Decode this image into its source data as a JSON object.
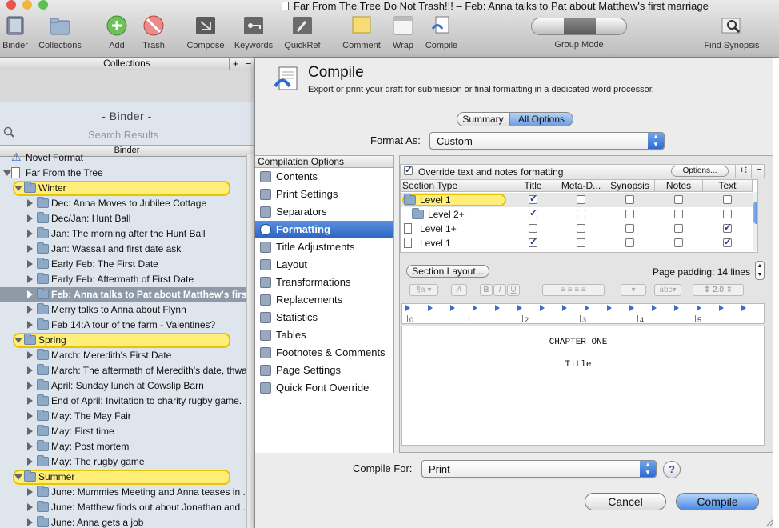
{
  "window": {
    "title": "Far From The Tree Do Not Trash!!! – Feb: Anna talks to Pat about Matthew's first marriage",
    "traffic_colors": [
      "#e9574c",
      "#f4b43f",
      "#5cc24e"
    ]
  },
  "toolbar": {
    "items": [
      {
        "label": "Binder",
        "icon": "binder-icon"
      },
      {
        "label": "Collections",
        "icon": "collections-icon"
      },
      {
        "label": "Add",
        "icon": "add-icon"
      },
      {
        "label": "Trash",
        "icon": "trash-icon"
      },
      {
        "label": "Compose",
        "icon": "compose-icon"
      },
      {
        "label": "Keywords",
        "icon": "keywords-icon"
      },
      {
        "label": "QuickRef",
        "icon": "quickref-icon"
      },
      {
        "label": "Comment",
        "icon": "comment-icon"
      },
      {
        "label": "Wrap",
        "icon": "wrap-icon"
      },
      {
        "label": "Compile",
        "icon": "compile-icon"
      },
      {
        "label": "Group Mode",
        "icon": "group-mode-icon"
      },
      {
        "label": "Find Synopsis",
        "icon": "find-synopsis-icon"
      }
    ]
  },
  "sidebar": {
    "collections_label": "Collections",
    "binder_heading": "- Binder -",
    "search_placeholder": "Search Results",
    "binder_bar": "Binder",
    "items": [
      {
        "label": "Novel Format",
        "kind": "warning",
        "indent": 0
      },
      {
        "label": "Far From the Tree",
        "kind": "doc",
        "indent": 0,
        "open": true
      },
      {
        "label": "Winter",
        "kind": "group",
        "indent": 1,
        "open": true
      },
      {
        "label": "Dec: Anna Moves to Jubilee Cottage",
        "kind": "folder",
        "indent": 2
      },
      {
        "label": "Dec/Jan: Hunt Ball",
        "kind": "folder",
        "indent": 2
      },
      {
        "label": "Jan: The morning after the Hunt Ball",
        "kind": "folder",
        "indent": 2
      },
      {
        "label": "Jan: Wassail and first date ask",
        "kind": "folder",
        "indent": 2
      },
      {
        "label": "Early Feb: The First Date",
        "kind": "folder",
        "indent": 2
      },
      {
        "label": "Early Feb: Aftermath of First Date",
        "kind": "folder",
        "indent": 2
      },
      {
        "label": "Feb: Anna talks to Pat about Matthew's first marriage",
        "kind": "folder",
        "indent": 2,
        "selected": true
      },
      {
        "label": "Merry talks to Anna about Flynn",
        "kind": "folder",
        "indent": 2
      },
      {
        "label": "Feb 14:A tour of the farm - Valentines?",
        "kind": "folder",
        "indent": 2
      },
      {
        "label": "Spring",
        "kind": "group",
        "indent": 1,
        "open": true
      },
      {
        "label": "March: Meredith's First Date",
        "kind": "folder",
        "indent": 2
      },
      {
        "label": "March: The aftermath of Meredith's date, thwarted passion",
        "kind": "folder",
        "indent": 2
      },
      {
        "label": "April: Sunday lunch at Cowslip Barn",
        "kind": "folder",
        "indent": 2
      },
      {
        "label": "End of April: Invitation to charity rugby game.",
        "kind": "folder",
        "indent": 2
      },
      {
        "label": "May: The May Fair",
        "kind": "folder",
        "indent": 2
      },
      {
        "label": "May: First time",
        "kind": "folder",
        "indent": 2
      },
      {
        "label": "May: Post mortem",
        "kind": "folder",
        "indent": 2
      },
      {
        "label": "May: The rugby game",
        "kind": "folder",
        "indent": 2
      },
      {
        "label": "Summer",
        "kind": "group",
        "indent": 1,
        "open": true
      },
      {
        "label": "June:  Mummies Meeting and Anna teases in ...",
        "kind": "folder",
        "indent": 2
      },
      {
        "label": "June: Matthew finds out about Jonathan and ...",
        "kind": "folder",
        "indent": 2
      },
      {
        "label": "June: Anna gets a job",
        "kind": "folder",
        "indent": 2
      }
    ]
  },
  "compile": {
    "title": "Compile",
    "subtitle": "Export or print your draft for submission or final formatting in a dedicated word processor.",
    "tabs": [
      "Summary",
      "All Options"
    ],
    "format_as_label": "Format As:",
    "format_as_value": "Custom",
    "options_header": "Compilation Options",
    "options": [
      {
        "label": "Contents",
        "icon": "contents-icon"
      },
      {
        "label": "Print Settings",
        "icon": "printer-icon"
      },
      {
        "label": "Separators",
        "icon": "separators-icon"
      },
      {
        "label": "Formatting",
        "icon": "formatting-icon",
        "selected": true
      },
      {
        "label": "Title Adjustments",
        "icon": "title-adjust-icon"
      },
      {
        "label": "Layout",
        "icon": "layout-icon"
      },
      {
        "label": "Transformations",
        "icon": "transformations-icon"
      },
      {
        "label": "Replacements",
        "icon": "replacements-icon"
      },
      {
        "label": "Statistics",
        "icon": "statistics-icon"
      },
      {
        "label": "Tables",
        "icon": "tables-icon"
      },
      {
        "label": "Footnotes & Comments",
        "icon": "footnotes-icon"
      },
      {
        "label": "Page Settings",
        "icon": "page-settings-icon"
      },
      {
        "label": "Quick Font Override",
        "icon": "font-icon"
      }
    ],
    "override_label": "Override text and notes formatting",
    "options_button": "Options...",
    "columns": [
      "Section Type",
      "Title",
      "Meta-D...",
      "Synopsis",
      "Notes",
      "Text"
    ],
    "levels": [
      {
        "name": "Level  1",
        "kind": "folder",
        "checks": [
          true,
          false,
          false,
          false,
          false
        ],
        "highlight": true
      },
      {
        "name": "Level  2+",
        "kind": "folder",
        "checks": [
          true,
          false,
          false,
          false,
          false
        ]
      },
      {
        "name": "Level  1+",
        "kind": "doc",
        "checks": [
          false,
          false,
          false,
          false,
          true
        ]
      },
      {
        "name": "Level  1",
        "kind": "doc",
        "checks": [
          true,
          false,
          false,
          false,
          true
        ]
      }
    ],
    "section_layout_button": "Section Layout...",
    "page_padding": "Page padding: 14 lines",
    "line_spacing": "2.0",
    "ruler_numbers": [
      "0",
      "1",
      "2",
      "3",
      "4",
      "5"
    ],
    "preview": {
      "heading": "CHAPTER ONE",
      "title": "Title"
    },
    "compile_for_label": "Compile For:",
    "compile_for_value": "Print",
    "help": "?",
    "cancel": "Cancel",
    "compile": "Compile"
  }
}
